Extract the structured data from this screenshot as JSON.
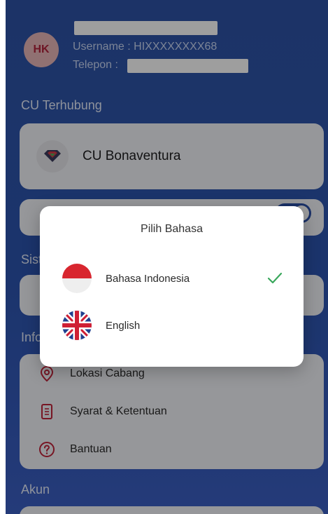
{
  "header": {
    "avatar_initials": "HK",
    "username": "Username : HIXXXXXXXX68",
    "phone_label": "Telepon :"
  },
  "sections": {
    "cu_title": "CU Terhubung",
    "sys_title_partial": "Sist",
    "info_title_partial": "Info",
    "akun_title": "Akun"
  },
  "cu": {
    "name": "CU Bonaventura"
  },
  "toggle": {
    "state": "on"
  },
  "info_items": [
    {
      "label": "Lokasi Cabang",
      "icon": "location-pin-icon"
    },
    {
      "label": "Syarat & Ketentuan",
      "icon": "document-icon"
    },
    {
      "label": "Bantuan",
      "icon": "help-circle-icon"
    }
  ],
  "dialog": {
    "title": "Pilih Bahasa",
    "options": [
      {
        "label": "Bahasa Indonesia",
        "icon": "indonesia-flag-icon",
        "selected": true
      },
      {
        "label": "English",
        "icon": "uk-flag-icon",
        "selected": false
      }
    ]
  },
  "colors": {
    "background": "#2e53a6",
    "avatar_bg": "#e9b6b9",
    "avatar_text": "#b2233b",
    "check": "#3aa85c",
    "card": "#f3f4f8",
    "icon_red": "#c0243b"
  }
}
